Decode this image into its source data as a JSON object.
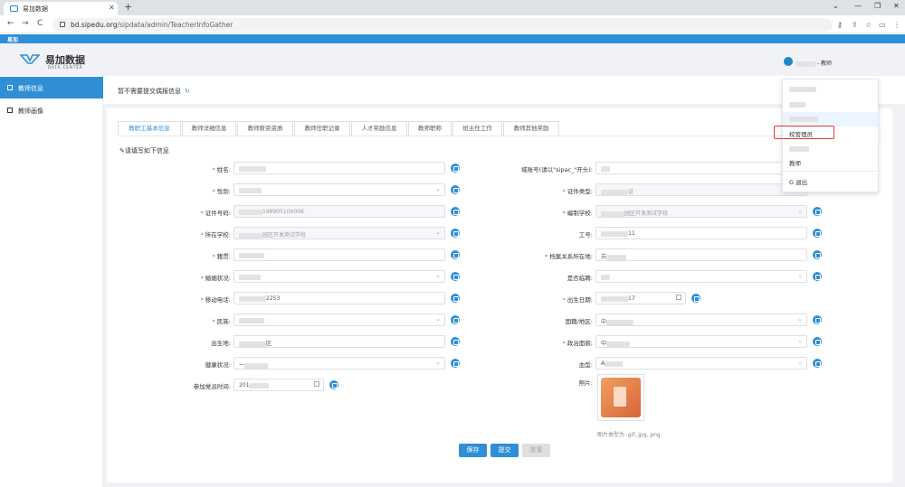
{
  "browser": {
    "tab_title": "易加数据",
    "url_domain": "bd.sipedu.org",
    "url_path": "/sipdata/admin/TeacherInfoGather",
    "nav": {
      "back": "←",
      "forward": "→",
      "reload": "C"
    },
    "window": {
      "minimize": "—",
      "restore": "❐",
      "close": "✕"
    }
  },
  "bookbar": {
    "label": "易加"
  },
  "header": {
    "logo_text": "易加数据",
    "logo_sub": "DATA CENTER",
    "user_suffix": "- 教师"
  },
  "sidebar": {
    "items": [
      {
        "label": "教师信息",
        "active": true
      },
      {
        "label": "教师画像",
        "active": false
      }
    ]
  },
  "notice": {
    "text": "暂不需要提交偶报信息"
  },
  "tabs": [
    {
      "label": "教职工基本信息",
      "active": true
    },
    {
      "label": "教师详细信息"
    },
    {
      "label": "教师薪资资质"
    },
    {
      "label": "教师任职记录"
    },
    {
      "label": "人才奖励信息"
    },
    {
      "label": "教师职称"
    },
    {
      "label": "班主任工作"
    },
    {
      "label": "教师其他奖励"
    }
  ],
  "hint": "请填写如下信息",
  "form": {
    "left": [
      {
        "label": "姓名:",
        "req": true,
        "value": "",
        "type": "text"
      },
      {
        "label": "性别:",
        "req": true,
        "value": "",
        "type": "select"
      },
      {
        "label": "证件号码:",
        "req": true,
        "value": "198905106006",
        "type": "text",
        "disabled": true
      },
      {
        "label": "所在学校:",
        "req": true,
        "value": "园区开发测试学校",
        "type": "select",
        "disabled": true
      },
      {
        "label": "籍贯:",
        "req": true,
        "value": "",
        "type": "text"
      },
      {
        "label": "婚姻状况:",
        "req": true,
        "value": "",
        "type": "select"
      },
      {
        "label": "移动电话:",
        "req": true,
        "value": "2253",
        "type": "text"
      },
      {
        "label": "民族:",
        "req": true,
        "value": "",
        "type": "select"
      },
      {
        "label": "出生地:",
        "req": false,
        "value": "区",
        "type": "text"
      },
      {
        "label": "健康状况:",
        "req": false,
        "value": "一",
        "type": "select"
      },
      {
        "label": "参加党派时间:",
        "req": false,
        "value": "201",
        "type": "date"
      }
    ],
    "right": [
      {
        "label": "域账号(请以\"sipac_\"开头):",
        "req": false,
        "value": "",
        "type": "text"
      },
      {
        "label": "证件类型:",
        "req": true,
        "value": "证",
        "type": "select",
        "disabled": true
      },
      {
        "label": "编制学校:",
        "req": true,
        "value": "园区开发测试学校",
        "type": "select",
        "disabled": true
      },
      {
        "label": "工号:",
        "req": false,
        "value": "11",
        "type": "text"
      },
      {
        "label": "档案关系所在地:",
        "req": true,
        "value": "苏",
        "type": "text"
      },
      {
        "label": "是否临聘:",
        "req": false,
        "value": "",
        "type": "select"
      },
      {
        "label": "出生日期:",
        "req": true,
        "value": "17",
        "type": "date"
      },
      {
        "label": "国籍/地区:",
        "req": false,
        "value": "中",
        "type": "select"
      },
      {
        "label": "政治面貌:",
        "req": true,
        "value": "中",
        "type": "select"
      },
      {
        "label": "血型:",
        "req": false,
        "value": "A",
        "type": "select"
      },
      {
        "label": "照片:",
        "req": false,
        "value": "",
        "type": "photo"
      }
    ]
  },
  "photo_hint": "图片类型为 .gif,.jpg,.png",
  "buttons": {
    "save": "保存",
    "submit": "提交",
    "third": "重置"
  },
  "dropdown": {
    "items": [
      "",
      "",
      "",
      "校管理员",
      "",
      "教师"
    ],
    "logout": "退出"
  },
  "colors": {
    "primary": "#2e8fd6",
    "required": "#e74c3c",
    "highlight": "#e53935"
  }
}
